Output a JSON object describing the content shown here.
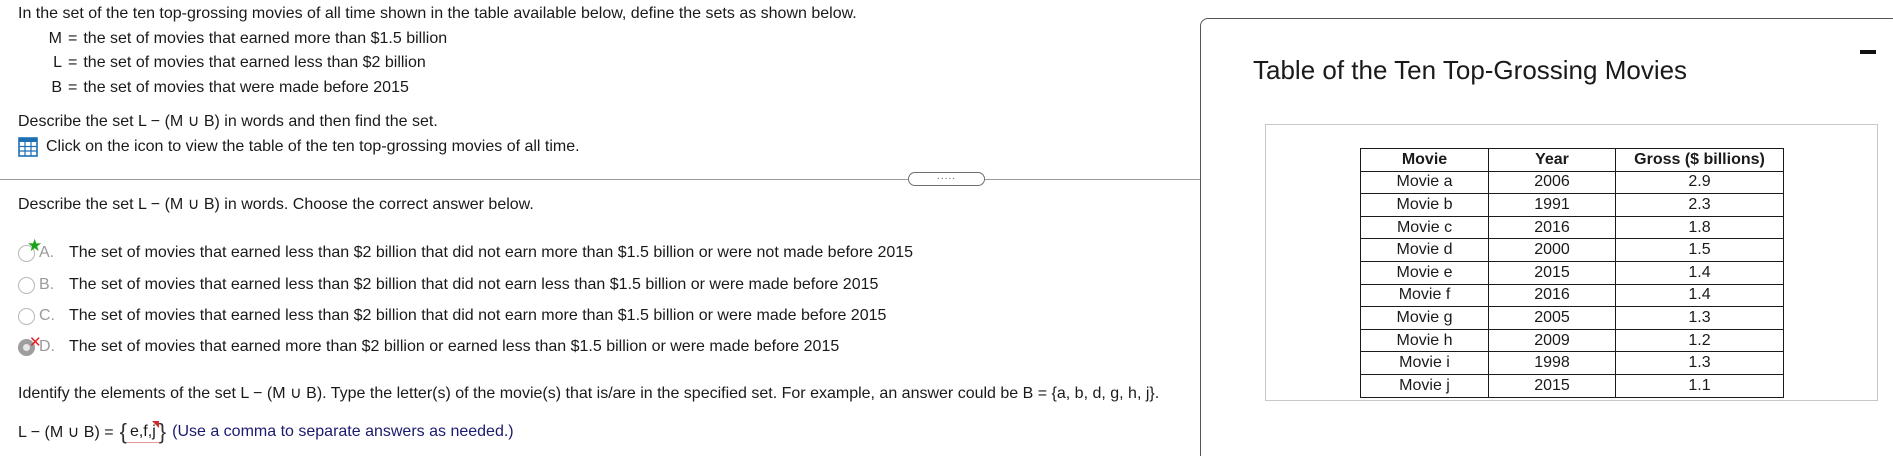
{
  "question": {
    "intro": "In the set of the ten top-grossing movies of all time shown in the table available below, define the sets as shown below.",
    "definitions": [
      {
        "symbol": "M",
        "eq": "=",
        "text": "the set of movies that earned more than $1.5 billion"
      },
      {
        "symbol": "L",
        "eq": "=",
        "text": "the set of movies that earned less than $2 billion"
      },
      {
        "symbol": "B",
        "eq": "=",
        "text": "the set of movies that were made before 2015"
      }
    ],
    "task": "Describe the set L − (M ∪ B) in words and then find the set.",
    "table_link": "Click on the icon to view the table of the ten top-grossing movies of all time."
  },
  "divider_handle": ".....",
  "part1": {
    "prompt": "Describe the set L − (M ∪ B) in words. Choose the correct answer below.",
    "choices": [
      {
        "letter": "A.",
        "text": "The set of movies that earned less than $2 billion that did not earn more than $1.5 billion or were not made before 2015",
        "state": "correct",
        "mark_icon": "green-star-icon"
      },
      {
        "letter": "B.",
        "text": "The set of movies that earned less than $2 billion that did not earn less than $1.5 billion or were made before 2015",
        "state": "unselected"
      },
      {
        "letter": "C.",
        "text": "The set of movies that earned less than $2 billion that did not earn more than $1.5 billion or were made before 2015",
        "state": "unselected"
      },
      {
        "letter": "D.",
        "text": "The set of movies that earned more than $2 billion or earned less than $1.5 billion or were made before 2015",
        "state": "selected-wrong",
        "mark_icon": "red-x-icon"
      }
    ]
  },
  "part2": {
    "prompt": "Identify the elements of the set L − (M ∪ B). Type the letter(s) of the movie(s) that is/are in the specified set. For example, an answer could be B = {a, b, d, g, h, j}.",
    "answer_label": "L − (M ∪ B) =",
    "answer_open": "{",
    "answer_value": "e,f,j",
    "answer_close": "}",
    "hint": "(Use a comma to separate answers as needed.)"
  },
  "panel": {
    "title": "Table of the Ten Top-Grossing Movies",
    "minimize_icon": "minimize-icon",
    "table": {
      "headers": [
        "Movie",
        "Year",
        "Gross ($ billions)"
      ],
      "rows": [
        [
          "Movie a",
          "2006",
          "2.9"
        ],
        [
          "Movie b",
          "1991",
          "2.3"
        ],
        [
          "Movie c",
          "2016",
          "1.8"
        ],
        [
          "Movie d",
          "2000",
          "1.5"
        ],
        [
          "Movie e",
          "2015",
          "1.4"
        ],
        [
          "Movie f",
          "2016",
          "1.4"
        ],
        [
          "Movie g",
          "2005",
          "1.3"
        ],
        [
          "Movie h",
          "2009",
          "1.2"
        ],
        [
          "Movie i",
          "1998",
          "1.3"
        ],
        [
          "Movie j",
          "2015",
          "1.1"
        ]
      ]
    }
  },
  "colors": {
    "accent_blue": "#1f6fb5",
    "correct_green": "#1aa31a",
    "wrong_red": "#e02020",
    "hint_navy": "#1a1a6e"
  }
}
